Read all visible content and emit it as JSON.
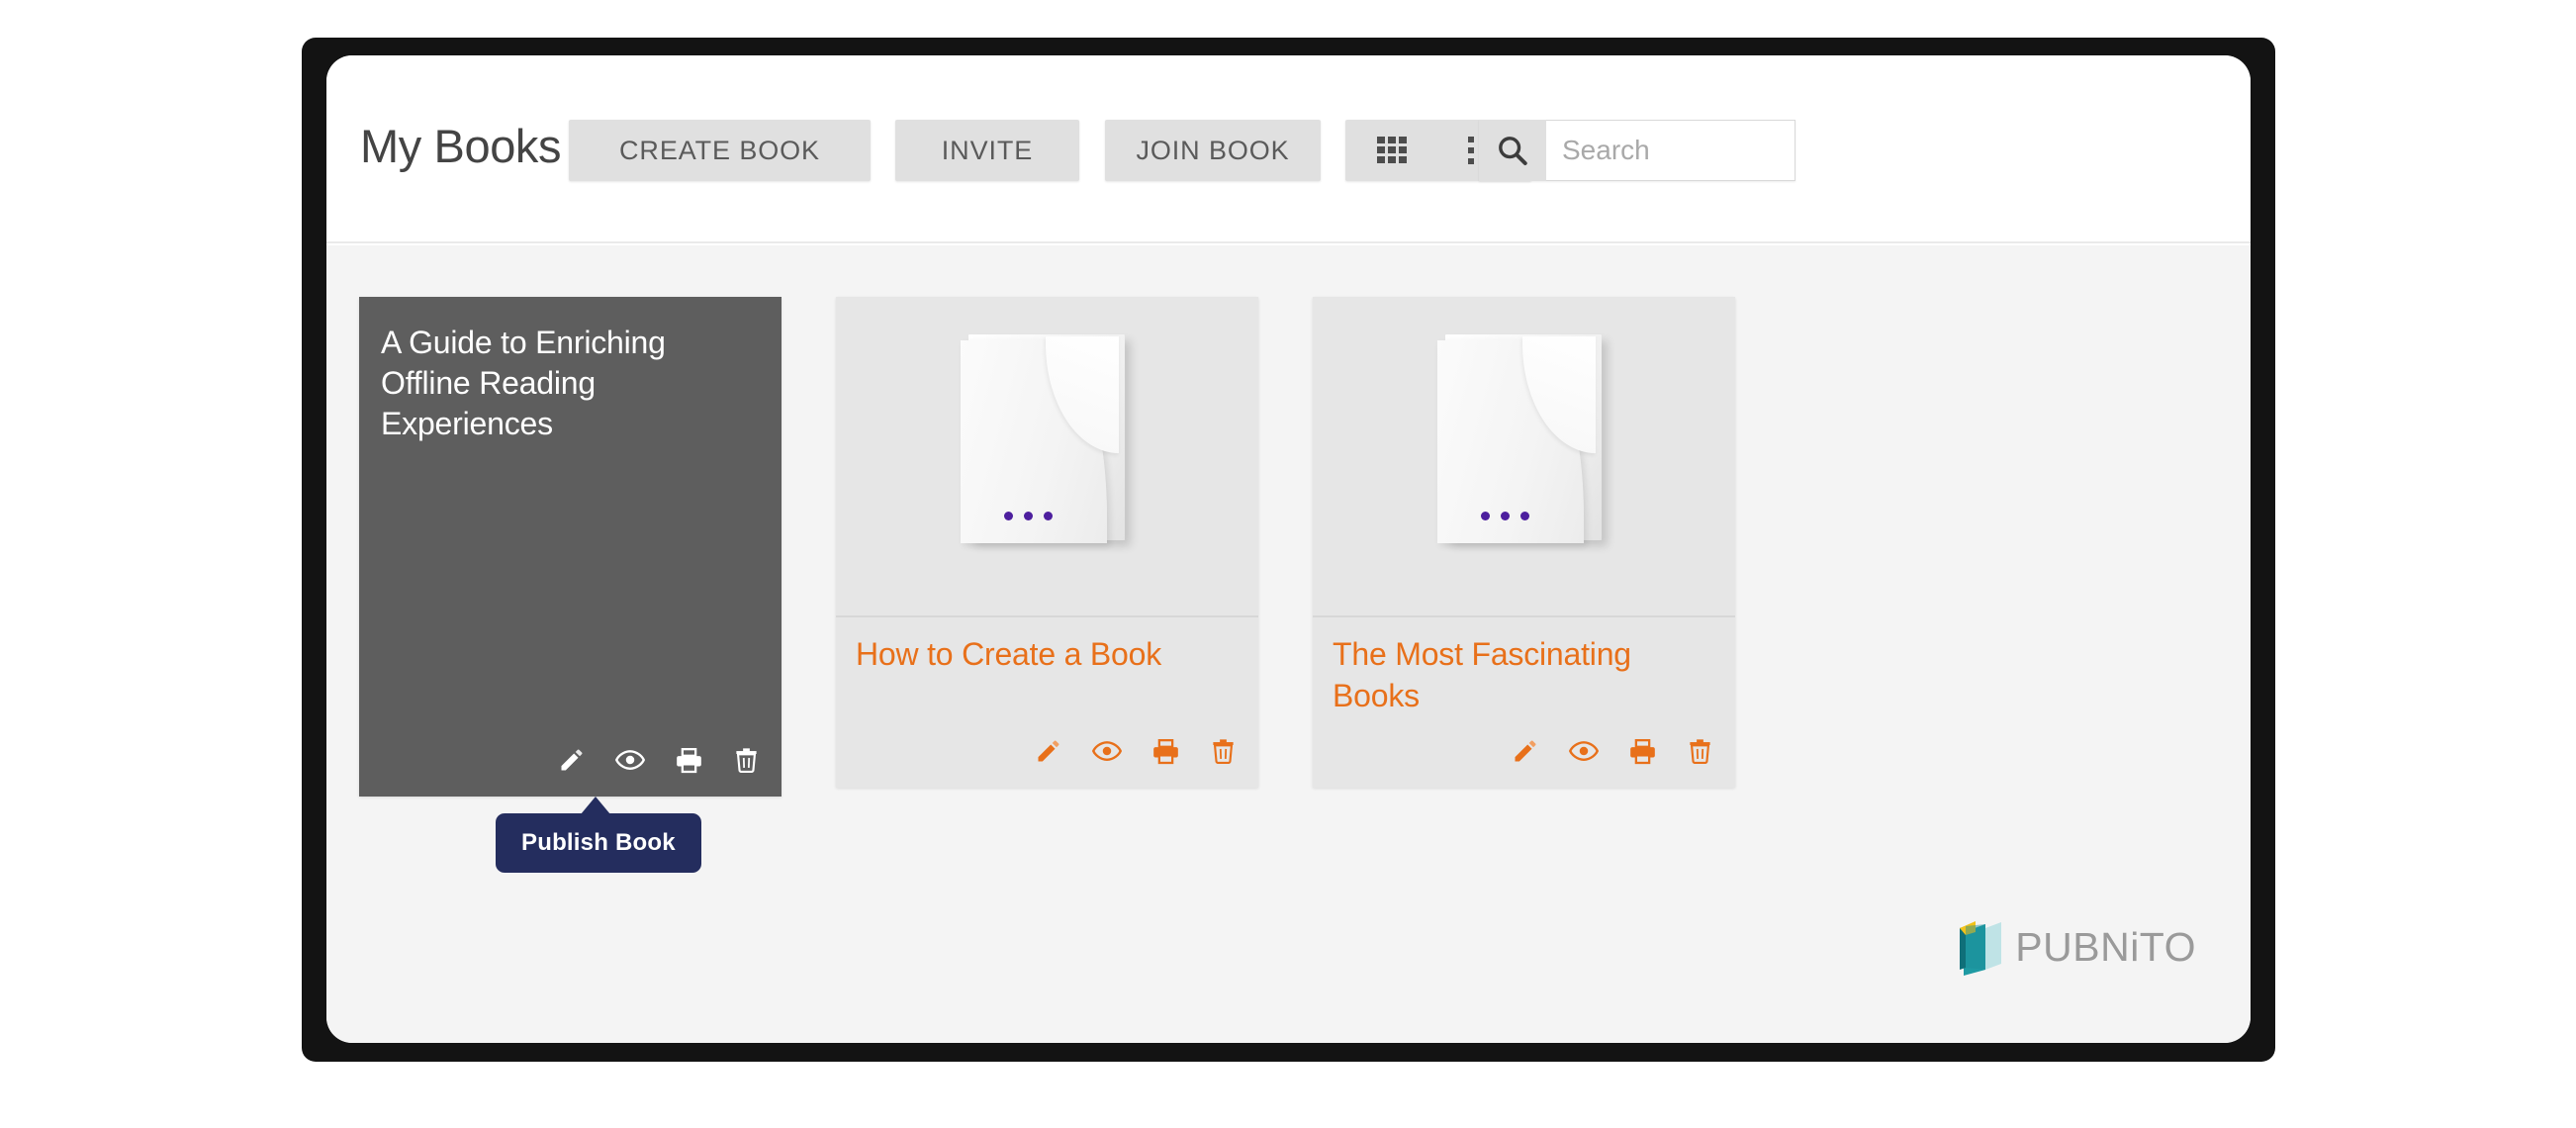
{
  "app": {
    "title": "My Books",
    "brand_name": "PUBNiTO"
  },
  "toolbar": {
    "create_book_label": "CREATE BOOK",
    "invite_label": "INVITE",
    "join_book_label": "JOIN BOOK",
    "grid_view_icon": "grid-view-icon",
    "list_view_icon": "list-view-icon",
    "search_icon": "search-icon"
  },
  "search": {
    "placeholder": "Search",
    "value": ""
  },
  "books": [
    {
      "title": "A Guide to Enriching Offline Reading Experiences",
      "selected": true,
      "has_thumbnail": false,
      "actions": [
        "edit-icon",
        "preview-icon",
        "publish-icon",
        "delete-icon"
      ]
    },
    {
      "title": "How to Create a Book",
      "selected": false,
      "has_thumbnail": true,
      "actions": [
        "edit-icon",
        "preview-icon",
        "publish-icon",
        "delete-icon"
      ]
    },
    {
      "title": "The Most Fascinating Books",
      "selected": false,
      "has_thumbnail": true,
      "actions": [
        "edit-icon",
        "preview-icon",
        "publish-icon",
        "delete-icon"
      ]
    }
  ],
  "tooltip": {
    "label": "Publish Book"
  },
  "colors": {
    "accent_orange": "#e8701a",
    "selected_card_bg": "#5e5e5e",
    "card_bg": "#e6e6e6",
    "tooltip_bg": "#242d5e",
    "page_bg": "#f4f4f4",
    "book_dots": "#4d1f9e",
    "brand_teal": "#17818c",
    "brand_yellow": "#f2c219",
    "brand_text": "#9a9a9a"
  }
}
